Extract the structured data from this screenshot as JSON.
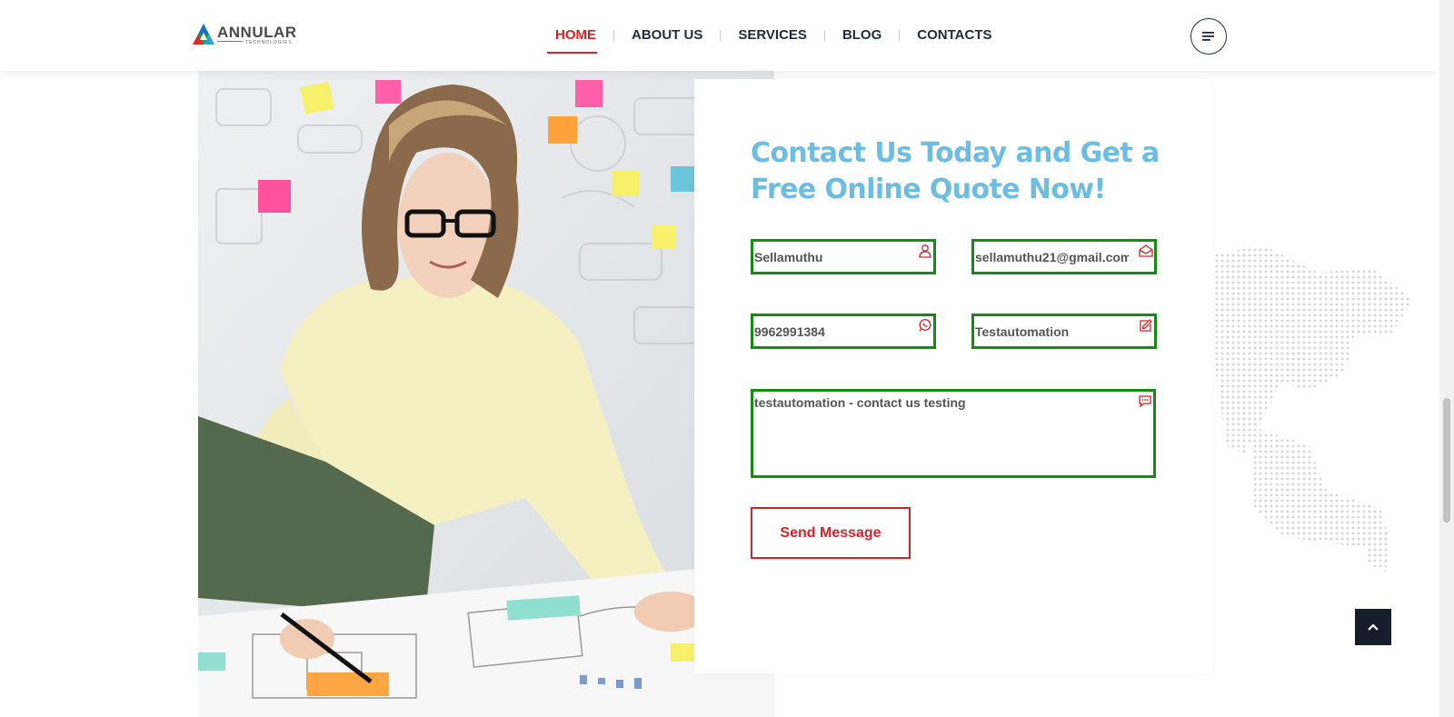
{
  "brand": {
    "name": "ANNULAR",
    "sub": "TECHNOLOGIES"
  },
  "nav": [
    {
      "label": "HOME",
      "active": true
    },
    {
      "label": "ABOUT US"
    },
    {
      "label": "SERVICES"
    },
    {
      "label": "BLOG"
    },
    {
      "label": "CONTACTS"
    }
  ],
  "contact": {
    "heading": "Contact Us Today and Get a Free Online Quote Now!",
    "fields": {
      "name": {
        "value": "Sellamuthu",
        "icon": "user-icon"
      },
      "email": {
        "value": "sellamuthu21@gmail.com",
        "icon": "envelope-open-icon"
      },
      "phone": {
        "value": "9962991384",
        "icon": "whatsapp-icon"
      },
      "subject": {
        "value": "Testautomation",
        "icon": "edit-icon"
      },
      "message": {
        "value": "testautomation - contact us testing",
        "icon": "chat-icon"
      }
    },
    "submit_label": "Send Message"
  },
  "colors": {
    "accent": "#d4232b",
    "heading": "#6cbde4",
    "field_border": "#158a15",
    "dark": "#161e2b"
  }
}
